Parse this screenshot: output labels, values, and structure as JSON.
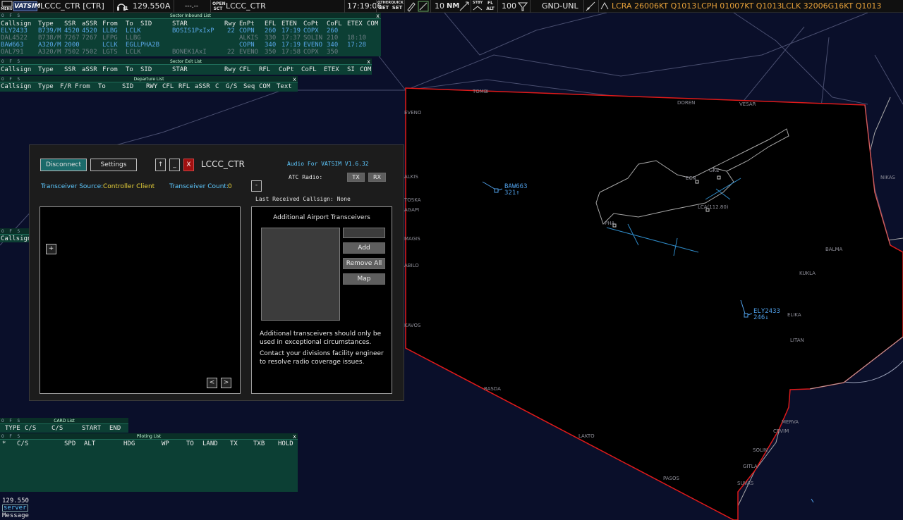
{
  "toolbar": {
    "menu_label": "MENU",
    "logo": "VATSIM",
    "callsign": "LCCC_CTR [CTR]",
    "headset_count": "1",
    "frequency": "129.550",
    "atis_letter": "A",
    "atis_code": "---.--",
    "open_label": "OPEN",
    "sct_label": "SCT",
    "open_sector": "LCCC_CTR",
    "time": "17:19:06",
    "other_set_top": "OTHER",
    "other_set_bottom": "SET",
    "quick_set_top": "QUICK",
    "quick_set_bottom": "SET",
    "range": "10",
    "range_unit": "NM",
    "stby_label": "STBY",
    "fl_label": "FL",
    "alt_label": "ALT",
    "filter_value": "100",
    "filter_range": "GND-UNL",
    "metars": [
      "LCRA 26006KT Q1013",
      "LCPH 01007KT Q1013",
      "LCLK 32006G16KT Q1013"
    ]
  },
  "inbound_list": {
    "title": "Sector Inbound List",
    "ofs": "O F S",
    "close": "x",
    "headers": [
      "Callsign",
      "Type",
      "SSR",
      "aSSR",
      "From",
      "To",
      "SID",
      "STAR",
      "Rwy",
      "EnPt",
      "EFL",
      "ETEN",
      "CoPt",
      "CoFL",
      "ETEX",
      "COM"
    ],
    "rows": [
      {
        "color": "blue",
        "cells": [
          "ELY2433",
          "B739/M",
          "4520",
          "4520",
          "LLBG",
          "LCLK",
          "",
          "BOSIS1PxIxP",
          "22",
          "COPN",
          "260",
          "17:19",
          "COPX",
          "260",
          ""
        ]
      },
      {
        "color": "grey",
        "cells": [
          "DAL4522",
          "B738/M",
          "7267",
          "7267",
          "LFPG",
          "LLBG",
          "",
          "",
          "",
          "ALKIS",
          "330",
          "17:37",
          "SOLIN",
          "210",
          "18:10"
        ]
      },
      {
        "color": "blue",
        "cells": [
          "BAW663",
          "A320/M",
          "2000",
          "",
          "LCLK",
          "EGLL",
          "PHA2B",
          "",
          "",
          "COPN",
          "340",
          "17:19",
          "EVENO",
          "340",
          "17:28"
        ]
      },
      {
        "color": "grey",
        "cells": [
          "OAL791",
          "A320/M",
          "7502",
          "7502",
          "LGTS",
          "LCLK",
          "",
          "BONEK1AxI",
          "22",
          "EVENO",
          "350",
          "17:58",
          "COPX",
          "350",
          ""
        ]
      }
    ]
  },
  "exit_list": {
    "title": "Sector Exit List",
    "ofs": "O F S",
    "close": "x",
    "headers": [
      "Callsign",
      "Type",
      "SSR",
      "aSSR",
      "From",
      "To",
      "SID",
      "STAR",
      "Rwy",
      "CFL",
      "RFL",
      "CoPt",
      "CoFL",
      "ETEX",
      "SI",
      "COM"
    ]
  },
  "departure_list": {
    "title": "Departure List",
    "ofs": "O F S",
    "close": "x",
    "headers": [
      "Callsign",
      "Type",
      "F/R",
      "From",
      "To",
      "SID",
      "RWY",
      "CFL",
      "RFL",
      "aSSR",
      "C",
      "G/S",
      "Seq",
      "COM",
      "Text"
    ]
  },
  "hidden_list": {
    "ofs": "O F S",
    "header": "Callsign"
  },
  "afv": {
    "disconnect": "Disconnect",
    "settings": "Settings",
    "up": "↑",
    "minimize": "_",
    "close": "X",
    "callsign": "LCCC_CTR",
    "version": "Audio For VATSIM V1.6.32",
    "atc_radio": "ATC Radio:",
    "tx": "TX",
    "rx": "RX",
    "source_label": "Transceiver Source:",
    "source_value": "Controller Client",
    "count_label": "Transceiver Count:",
    "count_value": "0",
    "dash": "-",
    "last_received": "Last Received Callsign:  None",
    "plus": "+",
    "prev": "<",
    "next": ">",
    "additional_title": "Additional Airport Transceivers",
    "add": "Add",
    "remove_all": "Remove All",
    "map": "Map",
    "note1": "Additional transceivers should only be used in exceptional circumstances.",
    "note2": "Contact your divisions facility engineer to resolve radio coverage issues."
  },
  "card_list": {
    "title": "CARD List",
    "ofs": "O F S",
    "close": "x",
    "headers": [
      "TYPE",
      "C/S",
      "C/S",
      "START",
      "END"
    ]
  },
  "piloting_list": {
    "title": "Piloting List",
    "ofs": "O F S",
    "close": "x",
    "star": "*",
    "headers": [
      "C/S",
      "SPD",
      "ALT",
      "HDG",
      "WP",
      "TO",
      "LAND",
      "TX",
      "TXB",
      "HOLD"
    ]
  },
  "bottom": {
    "frequency": "129.550",
    "server": "server",
    "message": "Message"
  },
  "map": {
    "fixes": [
      "TOMBI",
      "DOREN",
      "VESAR",
      "EVENO",
      "ALKIS",
      "TOSKA",
      "AGAPI",
      "MAGIS",
      "ABILO",
      "KAVOS",
      "NIKAS",
      "BALMA",
      "KUKLA",
      "ELIKA",
      "LITAN",
      "RASDA",
      "LAKTO",
      "PASOS",
      "MERVA",
      "CRVIM",
      "SOLIN",
      "GITLA",
      "SUVAS"
    ],
    "airports": [
      "GKE",
      "ECN",
      "LCA(112.80)",
      "PHA"
    ],
    "aircraft": [
      {
        "callsign": "BAW663",
        "alt": "321↑"
      },
      {
        "callsign": "ELY2433",
        "alt": "246↓"
      }
    ],
    "colors": {
      "sector_border": "#e01a1a",
      "aircraft": "#4f9fe8",
      "coast": "#a8a8a8",
      "airways": "#4a4f70"
    }
  }
}
